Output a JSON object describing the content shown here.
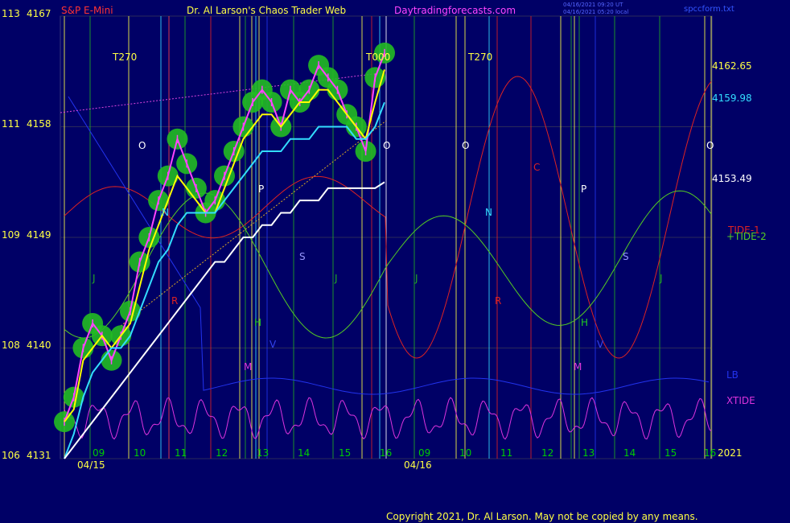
{
  "header": {
    "instrument": "S&P E-Mini",
    "title": "Dr. Al Larson's Chaos Trader Web",
    "site": "Daytradingforecasts.com",
    "timestamp1": "04/16/2021 09:20 UT",
    "timestamp2": "04/16/2021 05:20 local",
    "file": "spccform.txt"
  },
  "footer": {
    "copyright": "Copyright 2021, Dr. Al Larson. May not be copied by any means."
  },
  "colors": {
    "background": "#000066",
    "price_bars": "#ff44ff",
    "ema_yellow": "#ffff00",
    "ema_cyan": "#33ddff",
    "ema_white": "#ffffff",
    "tide1": "#dd2222",
    "tide2": "#55cc22",
    "xtide": "#dd33dd",
    "lb": "#2233ee",
    "green_glow": "#22bb22"
  },
  "chart_data": {
    "type": "line",
    "y_ticks": [
      {
        "left": "113",
        "price": "4167"
      },
      {
        "left": "111",
        "price": "4158"
      },
      {
        "left": "109",
        "price": "4149"
      },
      {
        "left": "108",
        "price": "4140"
      },
      {
        "left": "106",
        "price": "4131"
      }
    ],
    "ylim": [
      4131,
      4167
    ],
    "hour_labels": [
      "09",
      "10",
      "11",
      "12",
      "13",
      "14",
      "15",
      "16",
      "09",
      "10",
      "11",
      "12",
      "13",
      "14",
      "15",
      "16"
    ],
    "date_labels": [
      "04/15",
      "04/16"
    ],
    "year_label": "2021",
    "right_price_labels": [
      {
        "text": "4162.65",
        "value": 4162.65
      },
      {
        "text": "4159.98",
        "value": 4159.98
      },
      {
        "text": "4153.49",
        "value": 4153.49
      }
    ],
    "legend_right": [
      "TIDE-1",
      "+TIDE-2",
      "LB",
      "XTIDE"
    ],
    "event_labels": [
      "T270",
      "T000",
      "T270",
      "O",
      "O",
      "O",
      "O",
      "N",
      "N",
      "P",
      "P",
      "S",
      "S",
      "J",
      "J",
      "J",
      "J",
      "R",
      "R",
      "H",
      "H",
      "V",
      "V",
      "M",
      "M",
      "C"
    ],
    "price_close": [
      4134,
      4136,
      4140,
      4142,
      4141,
      4139,
      4141,
      4143,
      4147,
      4149,
      4152,
      4154,
      4157,
      4155,
      4153,
      4151,
      4152,
      4154,
      4156,
      4158,
      4160,
      4161,
      4160,
      4158,
      4161,
      4160,
      4161,
      4163,
      4162,
      4161,
      4159,
      4158,
      4156,
      4162,
      4164
    ],
    "ema_yellow": [
      4134,
      4135,
      4139,
      4140,
      4141,
      4140,
      4141,
      4142,
      4145,
      4148,
      4150,
      4152,
      4154,
      4153,
      4152,
      4151,
      4151,
      4153,
      4155,
      4157,
      4158,
      4159,
      4159,
      4158,
      4159,
      4160,
      4160,
      4161,
      4161,
      4160,
      4159,
      4158,
      4157,
      4160,
      4162.65
    ],
    "ema_cyan": [
      4131,
      4133,
      4136,
      4138,
      4139,
      4140,
      4140,
      4141,
      4143,
      4145,
      4147,
      4148,
      4150,
      4151,
      4151,
      4151,
      4151,
      4152,
      4153,
      4154,
      4155,
      4156,
      4156,
      4156,
      4157,
      4157,
      4157,
      4158,
      4158,
      4158,
      4158,
      4157,
      4157,
      4158,
      4159.98
    ],
    "ema_white": [
      4131,
      4132,
      4133,
      4134,
      4135,
      4136,
      4137,
      4138,
      4139,
      4140,
      4141,
      4142,
      4143,
      4144,
      4145,
      4146,
      4147,
      4147,
      4148,
      4149,
      4149,
      4150,
      4150,
      4151,
      4151,
      4152,
      4152,
      4152,
      4153,
      4153,
      4153,
      4153,
      4153,
      4153,
      4153.49
    ]
  }
}
